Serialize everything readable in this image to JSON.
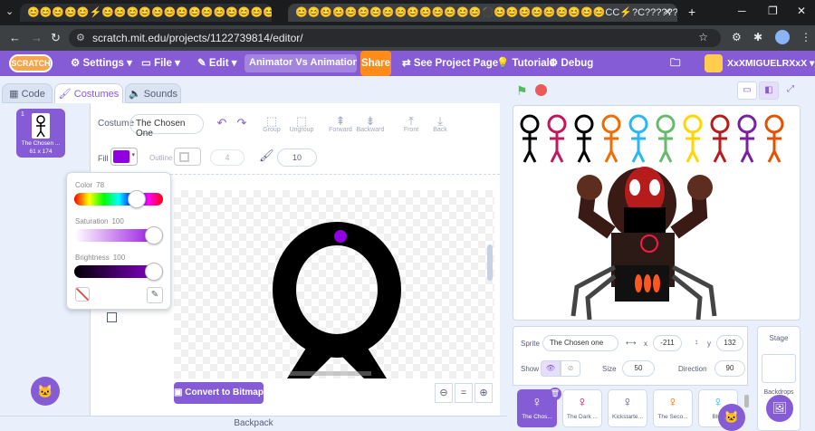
{
  "browser": {
    "tabs": [
      {
        "title": "😊😊😊😊😊⚡😊😊😊😊😊😊😊😊😊😊😊😊😊😊"
      },
      {
        "title": "😊😊😊😊😊😊😊😊😊😊😊😊😊😊😊⚫😊😊😊😊😊😊😊😊😊CC⚡?C?????????????"
      }
    ],
    "url": "scratch.mit.edu/projects/1122739814/editor/"
  },
  "menubar": {
    "logo": "SCRATCH",
    "settings": "Settings",
    "file": "File",
    "edit": "Edit",
    "project_title": "Animator Vs Animation Ve...",
    "share": "Share",
    "see_project_page": "See Project Page",
    "tutorials": "Tutorials",
    "debug": "Debug",
    "username": "XxXMIGUELRXxX"
  },
  "editor_tabs": {
    "code": "Code",
    "costumes": "Costumes",
    "sounds": "Sounds"
  },
  "costume_list": [
    {
      "number": "1",
      "name": "The Chosen ...",
      "size": "61 x 174"
    }
  ],
  "paint": {
    "costume_label": "Costume",
    "costume_name": "The Chosen One",
    "tools": [
      "Group",
      "Ungroup",
      "Forward",
      "Backward",
      "Front",
      "Back"
    ],
    "fill_label": "Fill",
    "outline_label": "Outline",
    "outline_width": "4",
    "brush_size": "10",
    "fill_color": "#9000e0",
    "convert_button": "Convert to Bitmap",
    "zoom_out": "⊖",
    "zoom_reset": "=",
    "zoom_in": "⊕"
  },
  "color_picker": {
    "color_label": "Color",
    "color_value": "78",
    "color_level": 0.78,
    "saturation_label": "Saturation",
    "saturation_value": "100",
    "saturation_level": 1.0,
    "brightness_label": "Brightness",
    "brightness_value": "100",
    "brightness_level": 1.0
  },
  "sprite_info": {
    "sprite_label": "Sprite",
    "sprite_name": "The Chosen one",
    "x_label": "x",
    "x_value": "-211",
    "y_label": "y",
    "y_value": "132",
    "show_label": "Show",
    "size_label": "Size",
    "size_value": "50",
    "direction_label": "Direction",
    "direction_value": "90"
  },
  "sprites": [
    "The Chos...",
    "The Dark ...",
    "Kickstarte...",
    "The Seco...",
    "Blue"
  ],
  "stage_panel": {
    "stage_label": "Stage",
    "backdrops_label": "Backdrops"
  },
  "backpack": "Backpack",
  "stage_figures": {
    "colors": [
      "#000000",
      "#c2185b",
      "#000000",
      "#ef6c00",
      "#29b6f6",
      "#66bb6a",
      "#ffd600",
      "#b71c1c",
      "#7b1fa2",
      "#e65100"
    ]
  }
}
